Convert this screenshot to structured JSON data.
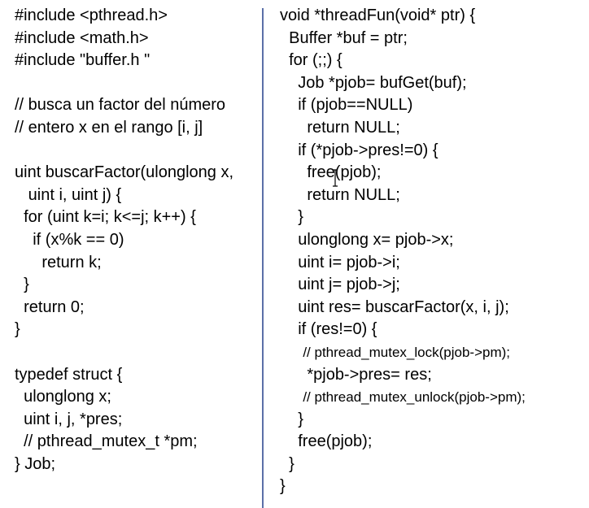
{
  "left_code": [
    {
      "text": "#include <pthread.h>"
    },
    {
      "text": "#include <math.h>"
    },
    {
      "text": "#include \"buffer.h \""
    },
    {
      "text": ""
    },
    {
      "text": "// busca un factor del número"
    },
    {
      "text": "// entero x en el rango [i, j]"
    },
    {
      "text": ""
    },
    {
      "text": "uint buscarFactor(ulonglong x,"
    },
    {
      "text": "   uint i, uint j) {"
    },
    {
      "text": "  for (uint k=i; k<=j; k++) {"
    },
    {
      "text": "    if (x%k == 0)"
    },
    {
      "text": "      return k;"
    },
    {
      "text": "  }"
    },
    {
      "text": "  return 0;"
    },
    {
      "text": "}"
    },
    {
      "text": ""
    },
    {
      "text": "typedef struct {"
    },
    {
      "text": "  ulonglong x;"
    },
    {
      "text": "  uint i, j, *pres;"
    },
    {
      "text": "  // pthread_mutex_t *pm;"
    },
    {
      "text": "} Job;"
    }
  ],
  "right_code": [
    {
      "text": "void *threadFun(void* ptr) {",
      "small": false
    },
    {
      "text": "  Buffer *buf = ptr;",
      "small": false
    },
    {
      "text": "  for (;;) {",
      "small": false
    },
    {
      "text": "    Job *pjob= bufGet(buf);",
      "small": false
    },
    {
      "text": "    if (pjob==NULL)",
      "small": false
    },
    {
      "text": "      return NULL;",
      "small": false
    },
    {
      "text": "    if (*pjob->pres!=0) {",
      "small": false
    },
    {
      "text": "      free(pjob);",
      "small": false
    },
    {
      "text": "      return NULL;",
      "small": false
    },
    {
      "text": "    }",
      "small": false
    },
    {
      "text": "    ulonglong x= pjob->x;",
      "small": false
    },
    {
      "text": "    uint i= pjob->i;",
      "small": false
    },
    {
      "text": "    uint j= pjob->j;",
      "small": false
    },
    {
      "text": "    uint res= buscarFactor(x, i, j);",
      "small": false
    },
    {
      "text": "    if (res!=0) {",
      "small": false
    },
    {
      "text": "      // pthread_mutex_lock(pjob->pm);",
      "small": true
    },
    {
      "text": "      *pjob->pres= res;",
      "small": false
    },
    {
      "text": "      // pthread_mutex_unlock(pjob->pm);",
      "small": true
    },
    {
      "text": "    }",
      "small": false
    },
    {
      "text": "    free(pjob);",
      "small": false
    },
    {
      "text": "  }",
      "small": false
    },
    {
      "text": "}",
      "small": false
    }
  ],
  "colors": {
    "divider": "#5b6fa8",
    "text": "#000000",
    "background": "#ffffff"
  },
  "icons": {
    "cursor": "i-beam-cursor-icon"
  }
}
